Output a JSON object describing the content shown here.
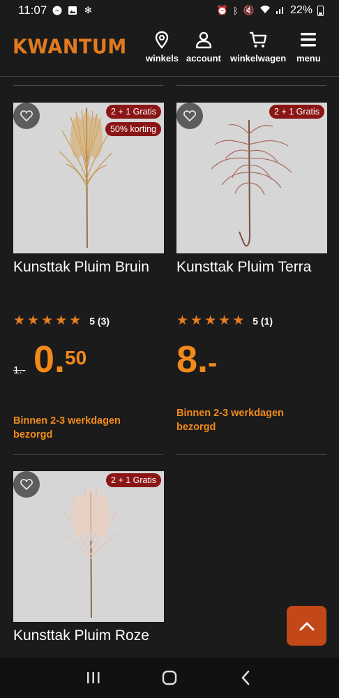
{
  "status_bar": {
    "time": "11:07",
    "battery": "22%"
  },
  "header": {
    "logo": "KWANTUM",
    "nav": [
      {
        "label": "winkels",
        "icon": "location-pin-icon"
      },
      {
        "label": "account",
        "icon": "user-icon"
      },
      {
        "label": "winkelwagen",
        "icon": "cart-icon"
      },
      {
        "label": "menu",
        "icon": "hamburger-menu-icon"
      }
    ]
  },
  "products": [
    {
      "title": "Kunsttak Pluim Bruin",
      "badges": [
        "2 + 1 Gratis",
        "50% korting"
      ],
      "rating": "5 (3)",
      "stars": 5,
      "old_price": "1.-",
      "price_whole": "0.",
      "price_cents": "50",
      "delivery": "Binnen 2-3 werkdagen bezorgd",
      "plume_color": "#c99a55"
    },
    {
      "title": "Kunsttak Pluim Terra",
      "badges": [
        "2 + 1 Gratis"
      ],
      "rating": "5 (1)",
      "stars": 5,
      "price_whole": "8.",
      "price_cents": "-",
      "delivery": "Binnen 2-3 werkdagen bezorgd",
      "plume_color": "#b07a6a"
    },
    {
      "title": "Kunsttak Pluim Roze",
      "badges": [
        "2 + 1 Gratis"
      ],
      "plume_color": "#e8c4b4"
    }
  ],
  "colors": {
    "accent": "#f28a1b",
    "badge": "#8a1515",
    "scroll_button": "#c24818"
  }
}
